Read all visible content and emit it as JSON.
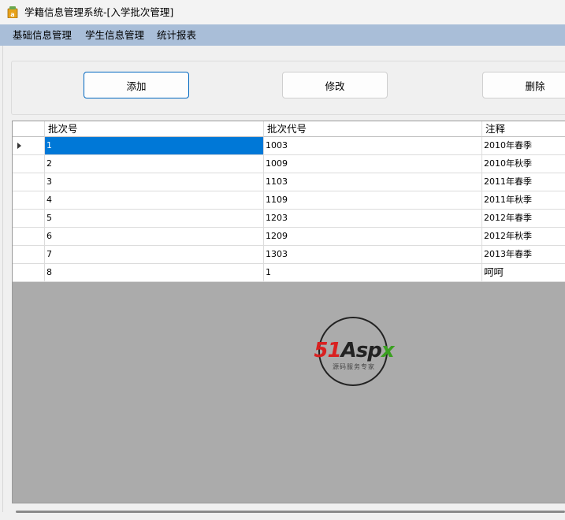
{
  "window": {
    "title": "学籍信息管理系统-[入学批次管理]"
  },
  "menu": {
    "items": [
      {
        "label": "基础信息管理"
      },
      {
        "label": "学生信息管理"
      },
      {
        "label": "统计报表"
      }
    ]
  },
  "toolbar": {
    "add_label": "添加",
    "edit_label": "修改",
    "delete_label": "删除"
  },
  "grid": {
    "columns": [
      "批次号",
      "批次代号",
      "注释"
    ],
    "rows": [
      {
        "id": "1",
        "code": "1003",
        "note": "2010年春季",
        "selected": true
      },
      {
        "id": "2",
        "code": "1009",
        "note": "2010年秋季"
      },
      {
        "id": "3",
        "code": "1103",
        "note": "2011年春季"
      },
      {
        "id": "4",
        "code": "1109",
        "note": "2011年秋季"
      },
      {
        "id": "5",
        "code": "1203",
        "note": "2012年春季"
      },
      {
        "id": "6",
        "code": "1209",
        "note": "2012年秋季"
      },
      {
        "id": "7",
        "code": "1303",
        "note": "2013年春季"
      },
      {
        "id": "8",
        "code": "1",
        "note": "呵呵"
      }
    ]
  },
  "watermark": {
    "brand": "51Aspx",
    "tagline": "源码服务专家"
  },
  "colors": {
    "menubar": "#a9bed8",
    "selection": "#0078d7",
    "grid_background": "#ababab"
  },
  "icons": {
    "app": "app-icon",
    "current_row": "row-indicator-icon"
  }
}
